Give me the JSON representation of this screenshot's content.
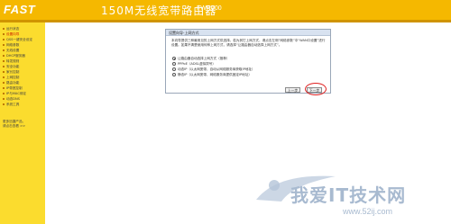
{
  "header": {
    "logo": "FAST",
    "title": "150M无线宽带路由器",
    "model": "FWR100"
  },
  "sidebar": {
    "items": [
      {
        "label": "运行状态"
      },
      {
        "label": "设置向导"
      },
      {
        "label": "QSS一键安全设定"
      },
      {
        "label": "网络参数"
      },
      {
        "label": "无线设置"
      },
      {
        "label": "DHCP服务器"
      },
      {
        "label": "转发规则"
      },
      {
        "label": "安全功能"
      },
      {
        "label": "家长控制"
      },
      {
        "label": "上网控制"
      },
      {
        "label": "路由功能"
      },
      {
        "label": "IP带宽控制"
      },
      {
        "label": "IP与MAC绑定"
      },
      {
        "label": "动态DNS"
      },
      {
        "label": "系统工具"
      }
    ],
    "more_line1": "更多迅捷产品，",
    "more_line2": "请点击查看 >>"
  },
  "wizard": {
    "title": "设置向导-上网方式",
    "description": "本向导提供三种最常见的上网方式供选择。若为其它上网方式，请点击左侧“网络参数”中“WAN口设置”进行设置。如果不清楚使用何种上网方式，请选择“让路由器自动选择上网方式”。",
    "options": [
      {
        "label": "让路由器自动选择上网方式（推荐）",
        "checked": true
      },
      {
        "label": "PPPoE（ADSL虚拟拨号）",
        "checked": false
      },
      {
        "label": "动态IP（以太网宽带，自动从网络服务商获取IP地址）",
        "checked": false
      },
      {
        "label": "静态IP（以太网宽带，网络服务商提供固定IP地址）",
        "checked": false
      }
    ],
    "back_label": "上一步",
    "next_label": "下一步"
  },
  "watermark": {
    "text": "我爱IT技术网",
    "url": "www.52ij.com"
  },
  "colors": {
    "header": "#f5b800",
    "sidebar": "#fbdc2e",
    "highlight": "#e02020"
  }
}
